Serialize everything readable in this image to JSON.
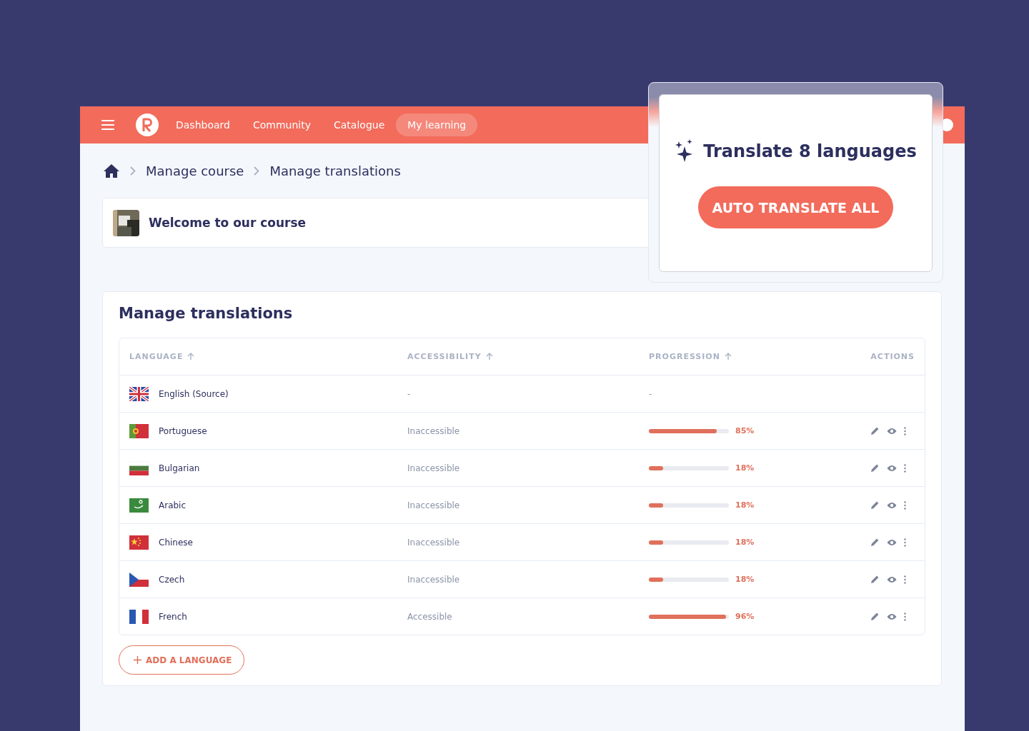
{
  "navbar": {
    "items": [
      {
        "label": "Dashboard",
        "selected": false
      },
      {
        "label": "Community",
        "selected": false
      },
      {
        "label": "Catalogue",
        "selected": false
      },
      {
        "label": "My learning",
        "selected": true
      }
    ]
  },
  "breadcrumb": [
    "Manage course",
    "Manage translations"
  ],
  "course": {
    "title": "Welcome to our course"
  },
  "panel": {
    "title": "Manage translations",
    "table": {
      "columns": [
        {
          "label": "LANGUAGE",
          "sortable": true
        },
        {
          "label": "ACCESSIBILITY",
          "sortable": true
        },
        {
          "label": "PROGRESSION",
          "sortable": true
        },
        {
          "label": "ACTIONS",
          "sortable": false
        }
      ],
      "rows": [
        {
          "kind": "gb",
          "language": "English (Source)",
          "accessibility": "-",
          "progression": "-",
          "actions": false
        },
        {
          "kind": "pt",
          "language": "Portuguese",
          "accessibility": "Inaccessible",
          "level": 0.85,
          "percent": "85%",
          "actions": true
        },
        {
          "kind": "bg",
          "language": "Bulgarian",
          "accessibility": "Inaccessible",
          "level": 0.18,
          "percent": "18%",
          "actions": true
        },
        {
          "kind": "sa",
          "language": "Arabic",
          "accessibility": "Inaccessible",
          "level": 0.18,
          "percent": "18%",
          "actions": true
        },
        {
          "kind": "cn",
          "language": "Chinese",
          "accessibility": "Inaccessible",
          "level": 0.18,
          "percent": "18%",
          "actions": true
        },
        {
          "kind": "cz",
          "language": "Czech",
          "accessibility": "Inaccessible",
          "level": 0.18,
          "percent": "18%",
          "actions": true
        },
        {
          "kind": "fr",
          "language": "French",
          "accessibility": "Accessible",
          "level": 0.96,
          "percent": "96%",
          "actions": true
        }
      ]
    },
    "add_button": "ADD A LANGUAGE"
  },
  "popup": {
    "title": "Translate 8 languages",
    "button": "AUTO TRANSLATE ALL"
  }
}
